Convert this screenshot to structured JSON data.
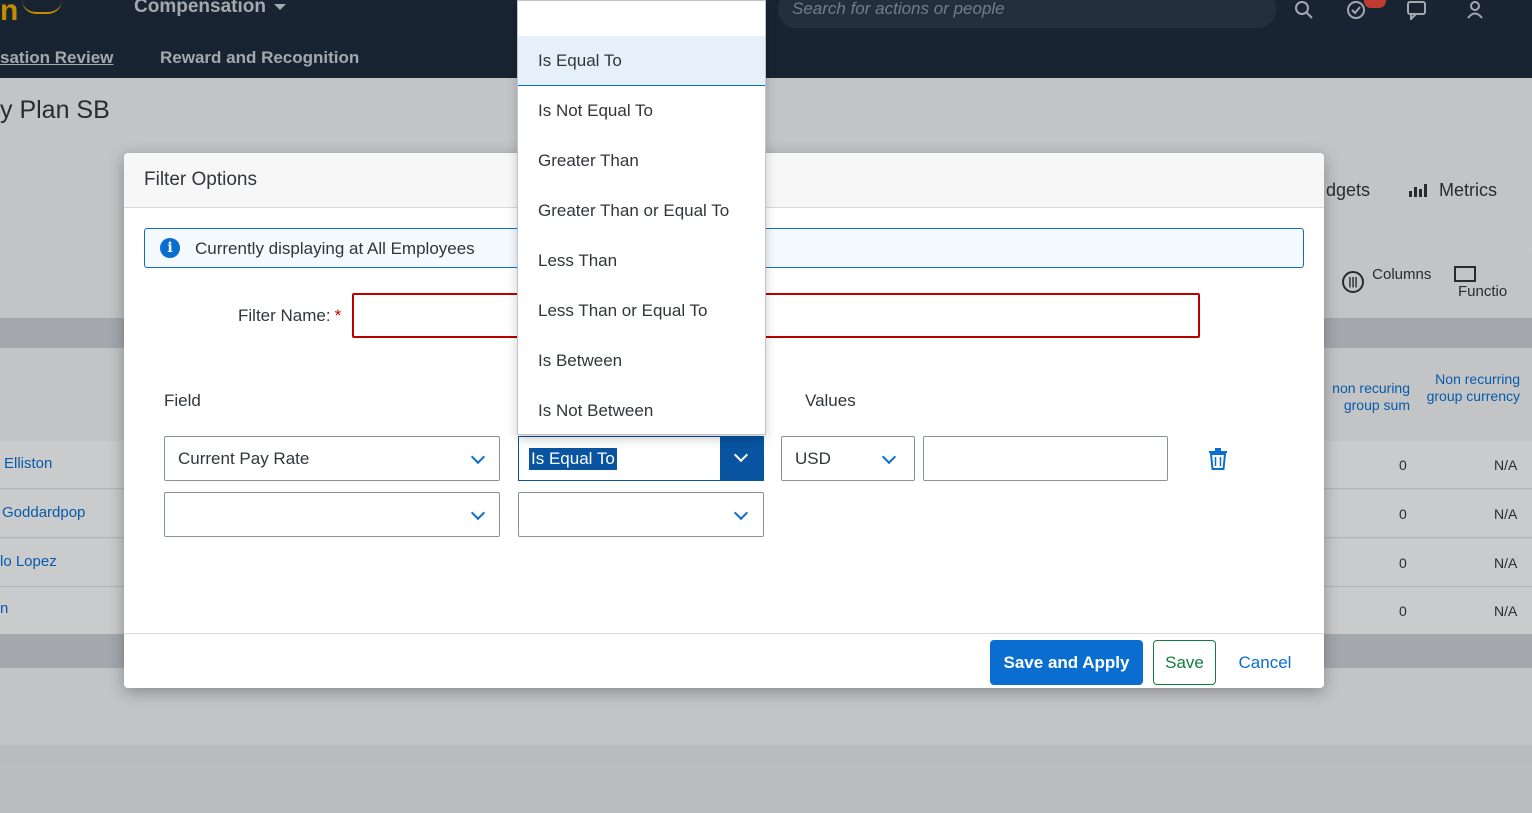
{
  "shell": {
    "logo": "n",
    "app_title": "Compensation",
    "search_placeholder": "Search for actions or people",
    "nav_tabs": [
      "sation Review",
      "Reward and Recognition"
    ]
  },
  "background": {
    "page_title": "y Plan SB",
    "tabs": [
      "dgets",
      "Metrics"
    ],
    "tools": [
      "Columns",
      "Functio"
    ],
    "headers": [
      "non recuring group sum",
      "Non recurring group currency"
    ],
    "rows": [
      {
        "name": "Elliston",
        "sum": "0",
        "currency": "N/A"
      },
      {
        "name": "Goddardpop",
        "sum": "0",
        "currency": "N/A"
      },
      {
        "name": "lo Lopez",
        "sum": "0",
        "currency": "N/A"
      },
      {
        "name": "n",
        "sum": "0",
        "currency": "N/A"
      }
    ]
  },
  "dialog": {
    "title": "Filter Options",
    "info_text": "Currently displaying at All Employees",
    "filter_name_label": "Filter Name:",
    "required_mark": "*",
    "filter_name_value": "",
    "field_header": "Field",
    "values_header": "Values",
    "row1": {
      "field": "Current Pay Rate",
      "operator": "Is Equal To",
      "currency": "USD",
      "value": ""
    },
    "row2": {
      "field": "",
      "operator": ""
    },
    "buttons": {
      "save_apply": "Save and Apply",
      "save": "Save",
      "cancel": "Cancel"
    }
  },
  "dropdown": {
    "options": [
      "Is Equal To",
      "Is Not Equal To",
      "Greater Than",
      "Greater Than or Equal To",
      "Less Than",
      "Less Than or Equal To",
      "Is Between",
      "Is Not Between"
    ],
    "selected": "Is Equal To"
  },
  "colors": {
    "shell": "#1f2d3d",
    "accent": "#0a6ed1",
    "error": "#bb0000",
    "positive": "#107e3e"
  }
}
